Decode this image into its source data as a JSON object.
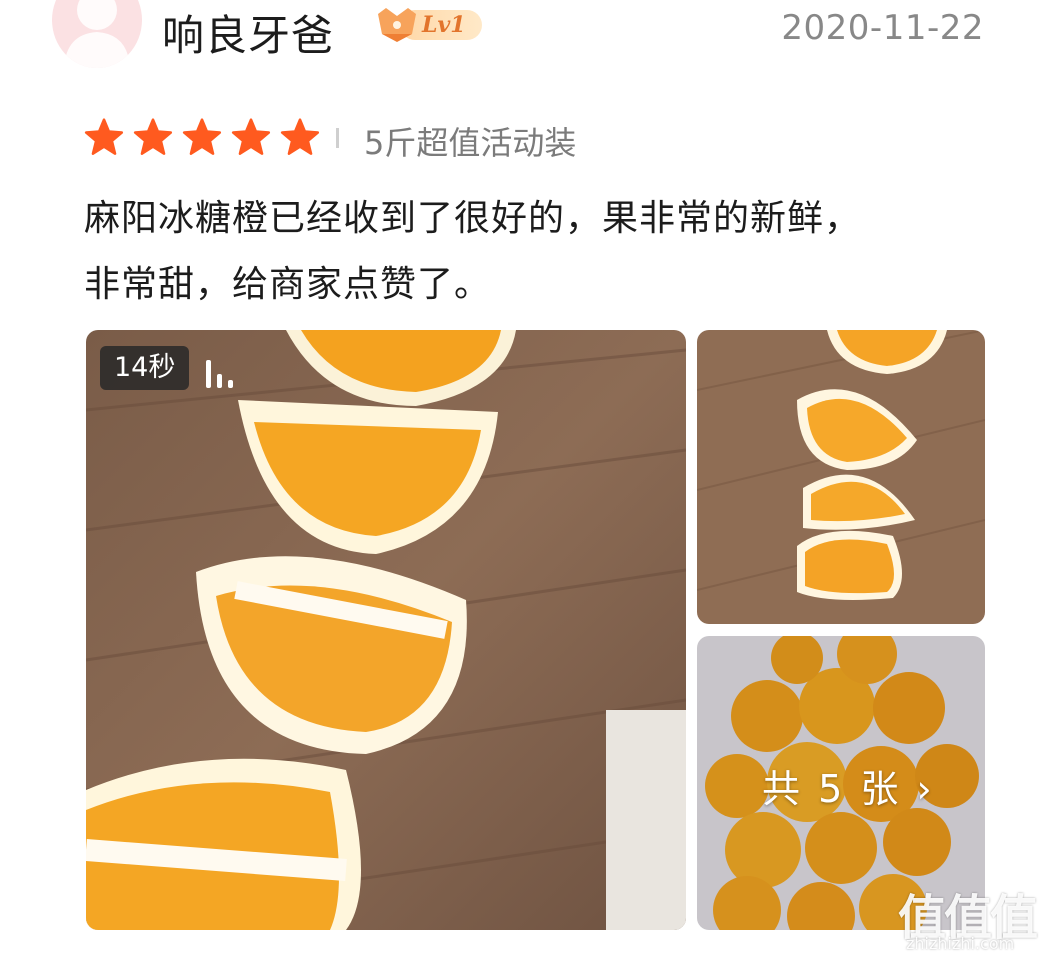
{
  "user": {
    "name": "响良牙爸",
    "level": "Lv1"
  },
  "date": "2020-11-22",
  "rating": {
    "stars": 5,
    "max": 5,
    "star_color": "#ff5a1f"
  },
  "variant": "5斤超值活动装",
  "review_text_line1": "麻阳冰糖橙已经收到了很好的，果非常的新鲜，",
  "review_text_line2": "非常甜，给商家点赞了。",
  "media": {
    "video_duration": "14秒",
    "total_photos_label": "共 5 张",
    "more_icon": "chevron-right-icon"
  },
  "watermark": {
    "logo": "值值值",
    "url": "zhizhizhi.com"
  }
}
